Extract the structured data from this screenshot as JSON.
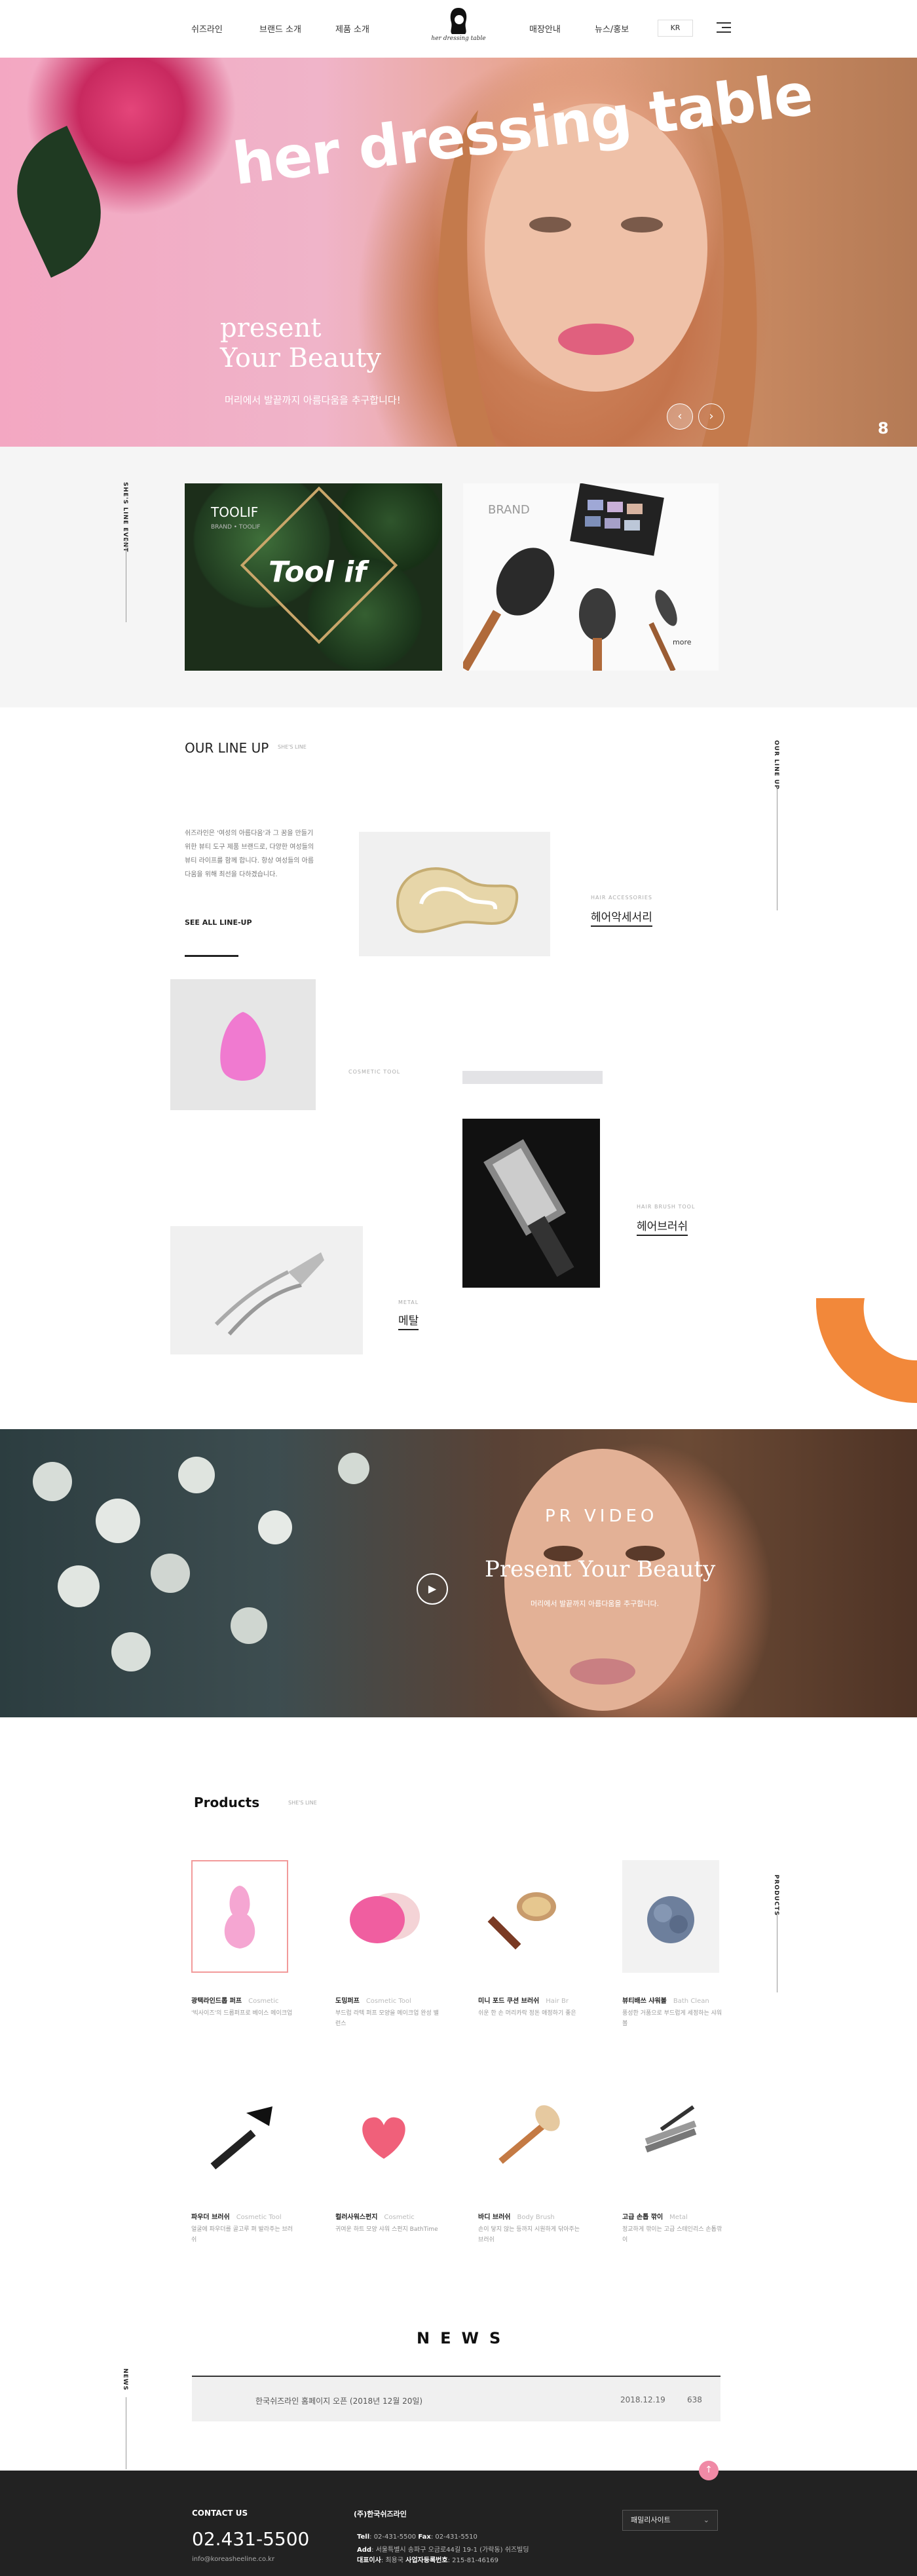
{
  "header": {
    "nav": [
      "쉬즈라인",
      "브랜드 소개",
      "제품 소개",
      "매장안내",
      "뉴스/홍보"
    ],
    "logo_text": "her dressing table",
    "lang": "KR",
    "menu_icon": "hamburger-icon"
  },
  "hero": {
    "title": "her dressing table",
    "sub1": "present",
    "sub2": "Your Beauty",
    "caption": "머리에서 발끝까지 아름다움을 추구합니다!",
    "prev": "‹",
    "next": "›",
    "mark": "8"
  },
  "event": {
    "side_label": "SHE'S LINE EVENT",
    "card1": {
      "title": "TOOLIF",
      "small": "BRAND • TOOLIF",
      "script": "Tool if"
    },
    "card2": {
      "title": "BRAND",
      "more": "more"
    }
  },
  "lineup": {
    "title": "OUR LINE UP",
    "sub": "SHE'S LINE",
    "side_label": "OUR LINE UP",
    "desc": "쉬즈라인은 '여성의 아름다움'과 그 꿈을 만들기 위한 뷰티 도구 제품 브랜드로, 다양한 여성들의 뷰티 라이프를 함께 합니다. 항상 여성들의 아름다움을 위해 최선을 다하겠습니다.",
    "see_all": "SEE ALL LINE-UP",
    "items": [
      {
        "tag": "HAIR ACCESSORIES",
        "name": "헤어악세서리"
      },
      {
        "tag": "COSMETIC TOOL",
        "name": ""
      },
      {
        "tag": "HAIR BRUSH TOOL",
        "name": "헤어브러쉬"
      },
      {
        "tag": "METAL",
        "name": "메탈"
      }
    ]
  },
  "video": {
    "title": "PR VIDEO",
    "subtitle": "Present Your Beauty",
    "caption": "머리에서 발끝까지 아름다움을 추구합니다.",
    "play": "▶"
  },
  "products": {
    "title": "Products",
    "sub": "SHE'S LINE",
    "side_label": "PRODUCTS",
    "items": [
      {
        "name": "광택라인드롭 퍼프",
        "cat": "Cosmetic",
        "desc": "'빅사이즈'의 드롭퍼프로 베이스 메이크업"
      },
      {
        "name": "도밍퍼프",
        "cat": "Cosmetic Tool",
        "desc": "부드럽 라텍 퍼프 모양을 메이크업 완성 밸런스"
      },
      {
        "name": "미니 포드 쿠션 브러쉬",
        "cat": "Hair Br",
        "desc": "쉬운 한 손 머리카락 정돈 애정하기 좋은"
      },
      {
        "name": "뷰티배쓰 샤워볼",
        "cat": "Bath Clean",
        "desc": "풍성한 거품으로 부드럽게 세정하는 샤워볼"
      },
      {
        "name": "파우더 브러쉬",
        "cat": "Cosmetic Tool",
        "desc": "얼굴에 파우더를 골고루 펴 발라주는 브러쉬"
      },
      {
        "name": "컬러사워스펀지",
        "cat": "Cosmetic",
        "desc": "귀여운 하트 모양 샤워 스펀지 BathTime"
      },
      {
        "name": "바디 브러쉬",
        "cat": "Body Brush",
        "desc": "손이 닿지 않는 등까지 시원하게 닦아주는 브러쉬"
      },
      {
        "name": "고급 손톱 깎이",
        "cat": "Metal",
        "desc": "정교하게 깎이는 고급 스테인리스 손톱깎이"
      }
    ]
  },
  "news": {
    "title": "NEWS",
    "side_label": "NEWS",
    "row": {
      "title": "한국쉬즈라인 홈페이지 오픈 (2018년 12월 20일)",
      "date": "2018.12.19",
      "views": "638"
    }
  },
  "footer": {
    "contact_label": "CONTACT US",
    "phone": "02.431-5500",
    "email": "info@koreasheeline.co.kr",
    "company": "(주)한국쉬즈라인",
    "line1_label": "Tell",
    "line1": ": 02-431-5500",
    "line1b_label": "Fax",
    "line1b": ": 02-431-5510",
    "line2_label": "Add",
    "line2": ": 서울특별시 송파구 오금로44길 19-1 (가락동) 쉬즈빌딩",
    "line3_label": "대표이사",
    "line3": ": 최용국",
    "line3b_label": "사업자등록번호",
    "line3b": ": 215-81-46169",
    "family": "패밀리사이트",
    "top": "↑"
  },
  "colors": {
    "accent": "#f2883a",
    "pink": "#f08aa6",
    "footer": "#222222"
  }
}
